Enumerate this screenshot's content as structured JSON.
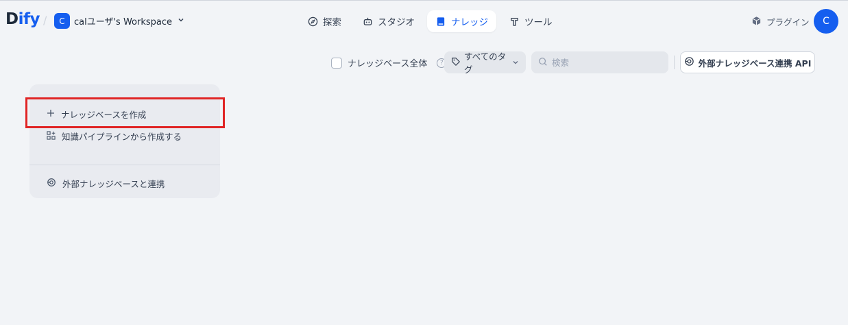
{
  "header": {
    "logo_main": "D",
    "logo_brand": "ify",
    "separator": "/",
    "workspace_badge": "C",
    "workspace_name": "calユーザ's Workspace",
    "nav": [
      {
        "label": "探索",
        "icon": "compass-icon"
      },
      {
        "label": "スタジオ",
        "icon": "robot-icon"
      },
      {
        "label": "ナレッジ",
        "icon": "book-icon",
        "active": true
      },
      {
        "label": "ツール",
        "icon": "hammer-icon"
      }
    ],
    "plugin_label": "プラグイン",
    "avatar_letter": "C"
  },
  "toolbar": {
    "all_knowledge_label": "ナレッジベース全体",
    "help_glyph": "?",
    "tags_label": "すべてのタグ",
    "search_placeholder": "検索",
    "external_api_label": "外部ナレッジベース連携 API"
  },
  "card": {
    "create_label": "ナレッジベースを作成",
    "pipeline_label": "知識パイプラインから作成する",
    "external_label": "外部ナレッジベースと連携"
  },
  "colors": {
    "accent": "#155eef",
    "background": "#f2f4f7",
    "highlight": "#e02424"
  }
}
